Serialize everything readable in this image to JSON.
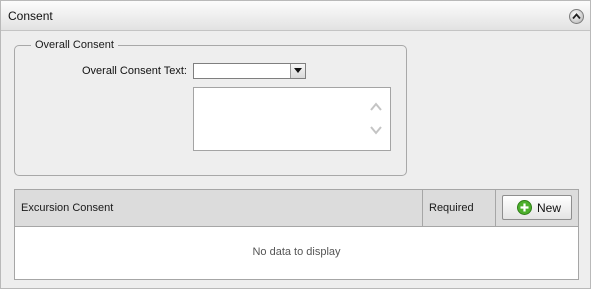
{
  "panel": {
    "title": "Consent",
    "collapse_icon": "chevron-up-icon"
  },
  "overall_consent": {
    "legend": "Overall Consent",
    "text_label": "Overall Consent Text:",
    "select_value": "",
    "textarea_value": ""
  },
  "excursion_grid": {
    "columns": [
      "Excursion Consent",
      "Required"
    ],
    "new_button_label": "New",
    "new_icon": "plus-circle-icon",
    "empty_message": "No data to display"
  },
  "colors": {
    "new_icon_green": "#4caf2c",
    "header_bg": "#dcdcdc"
  }
}
